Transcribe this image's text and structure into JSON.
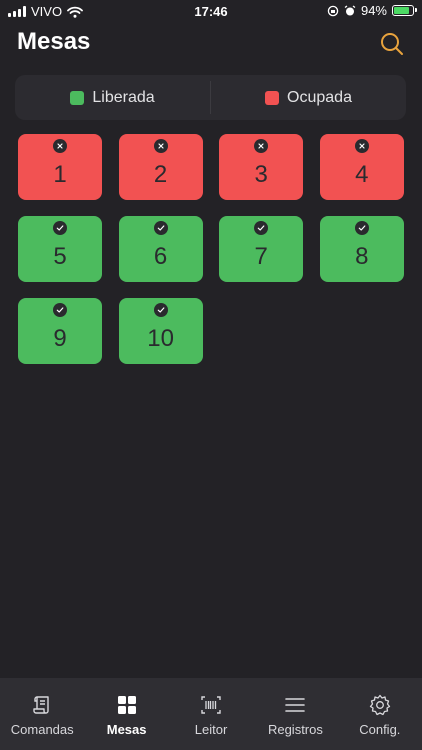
{
  "status_bar": {
    "carrier": "VIVO",
    "time": "17:46",
    "battery": "94%",
    "battery_level": 0.94
  },
  "header": {
    "title": "Mesas"
  },
  "legend": {
    "free_label": "Liberada",
    "occupied_label": "Ocupada"
  },
  "colors": {
    "free": "#4cbb5e",
    "occupied": "#f25252",
    "accent": "#e8a33d"
  },
  "tables": [
    {
      "number": "1",
      "status": "occupied"
    },
    {
      "number": "2",
      "status": "occupied"
    },
    {
      "number": "3",
      "status": "occupied"
    },
    {
      "number": "4",
      "status": "occupied"
    },
    {
      "number": "5",
      "status": "free"
    },
    {
      "number": "6",
      "status": "free"
    },
    {
      "number": "7",
      "status": "free"
    },
    {
      "number": "8",
      "status": "free"
    },
    {
      "number": "9",
      "status": "free"
    },
    {
      "number": "10",
      "status": "free"
    }
  ],
  "tabbar": {
    "items": [
      {
        "label": "Comandas",
        "icon": "scroll-icon",
        "active": false
      },
      {
        "label": "Mesas",
        "icon": "grid-icon",
        "active": true
      },
      {
        "label": "Leitor",
        "icon": "barcode-icon",
        "active": false
      },
      {
        "label": "Registros",
        "icon": "list-icon",
        "active": false
      },
      {
        "label": "Config.",
        "icon": "gear-icon",
        "active": false
      }
    ]
  }
}
